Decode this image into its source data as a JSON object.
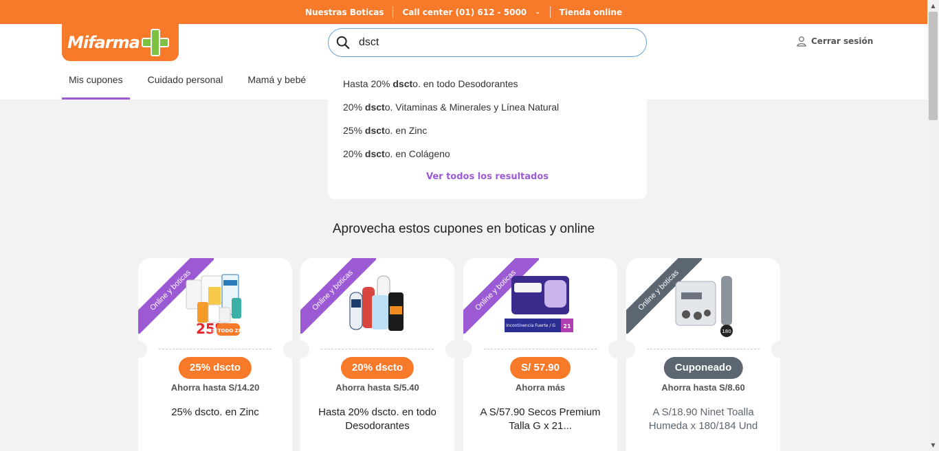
{
  "topbar": {
    "stores": "Nuestras Boticas",
    "call_center": "Call center (01) 612 - 5000",
    "online_store": "Tienda online"
  },
  "header": {
    "logo_text": "Mifarma",
    "search_value": "dsct",
    "logout": "Cerrar sesión"
  },
  "nav": {
    "items": [
      "Mis cupones",
      "Cuidado personal",
      "Mamá y bebé"
    ],
    "active": "Mis cupones"
  },
  "dropdown": {
    "suggestions": [
      {
        "pre": "Hasta 20% ",
        "match": "dsct",
        "post": "o. en todo Desodorantes"
      },
      {
        "pre": "20% ",
        "match": "dsct",
        "post": "o. Vitaminas & Minerales y Línea Natural"
      },
      {
        "pre": "25% ",
        "match": "dsct",
        "post": "o. en Zinc"
      },
      {
        "pre": "20% ",
        "match": "dsct",
        "post": "o. en Colágeno"
      }
    ],
    "see_all": "Ver todos los resultados"
  },
  "section_title": "Aprovecha estos cupones en boticas y online",
  "colors": {
    "orange": "#f7792a",
    "purple": "#9b59d4",
    "slate": "#5c6670",
    "green": "#7dc242"
  },
  "cards": [
    {
      "ribbon": "Online y boticas",
      "pill": "25% dscto",
      "save": "Ahorra hasta S/14.20",
      "desc": "25% dscto. en Zinc",
      "badge": "25%",
      "badge_sub": "EN TODO ZINC"
    },
    {
      "ribbon": "Online y boticas",
      "pill": "20% dscto",
      "save": "Ahorra hasta S/5.40",
      "desc": "Hasta 20% dscto. en todo Desodorantes"
    },
    {
      "ribbon": "Online y boticas",
      "pill": "S/ 57.90",
      "save": "Ahorra más",
      "desc": "A S/57.90 Secos Premium Talla G x 21...",
      "pack_text": "Incontinencia Fuerte / G",
      "pack_num": "21"
    },
    {
      "ribbon": "Online y boticas",
      "pill": "Cuponeado",
      "save": "Ahorra hasta S/8.60",
      "desc": "A S/18.90 Ninet Toalla Humeda x 180/184 Und",
      "pack_num": "180"
    }
  ]
}
